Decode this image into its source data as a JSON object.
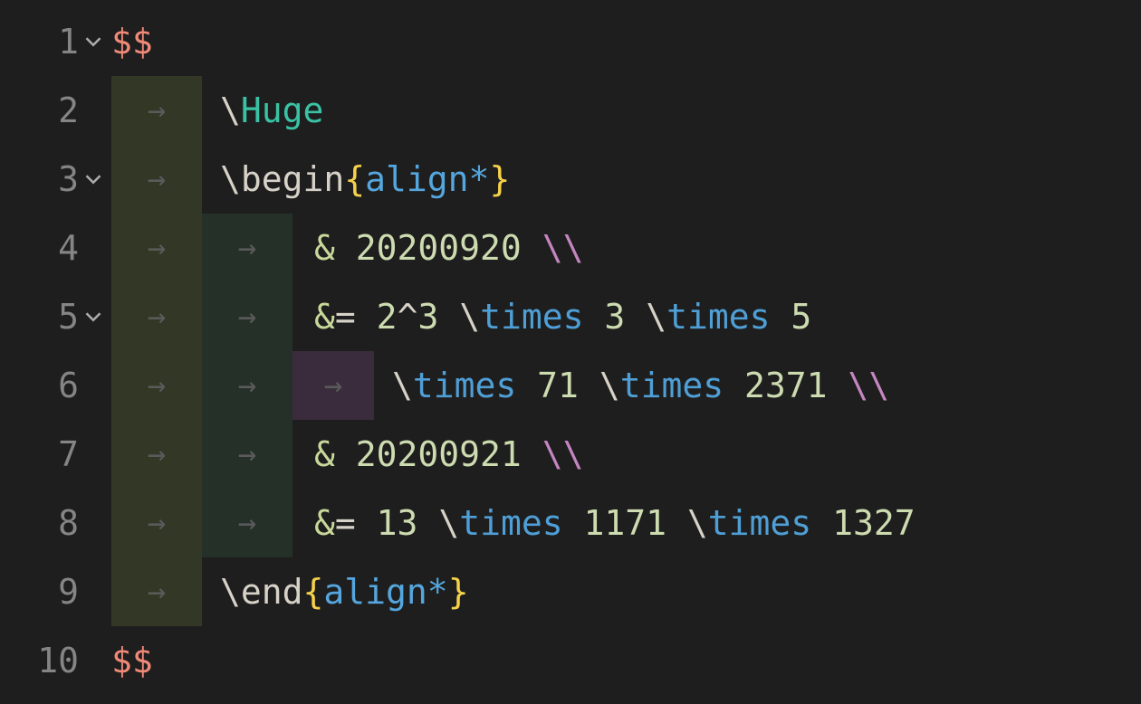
{
  "editor": {
    "lines": {
      "l1": {
        "num": "1",
        "delim": "$$"
      },
      "l2": {
        "num": "2",
        "backslash": "\\",
        "cmd": "Huge"
      },
      "l3": {
        "num": "3",
        "backslash": "\\",
        "cmd": "begin",
        "lbrace": "{",
        "env": "align*",
        "rbrace": "}"
      },
      "l4": {
        "num": "4",
        "amp": "&",
        "val": "20200920",
        "bs": "\\\\"
      },
      "l5": {
        "num": "5",
        "amp": "&",
        "eq": "=",
        "base": "2",
        "caret": "^",
        "exp": "3",
        "t1b": "\\",
        "t1": "times",
        "n1": "3",
        "t2b": "\\",
        "t2": "times",
        "n2": "5"
      },
      "l6": {
        "num": "6",
        "t1b": "\\",
        "t1": "times",
        "n1": "71",
        "t2b": "\\",
        "t2": "times",
        "n2": "2371",
        "bs": "\\\\"
      },
      "l7": {
        "num": "7",
        "amp": "&",
        "val": "20200921",
        "bs": "\\\\"
      },
      "l8": {
        "num": "8",
        "amp": "&",
        "eq": "=",
        "n0": "13",
        "t1b": "\\",
        "t1": "times",
        "n1": "1171",
        "t2b": "\\",
        "t2": "times",
        "n2": "1327"
      },
      "l9": {
        "num": "9",
        "backslash": "\\",
        "cmd": "end",
        "lbrace": "{",
        "env": "align*",
        "rbrace": "}"
      },
      "l10": {
        "num": "10",
        "delim": "$$"
      }
    },
    "arrow_glyph": "→"
  }
}
